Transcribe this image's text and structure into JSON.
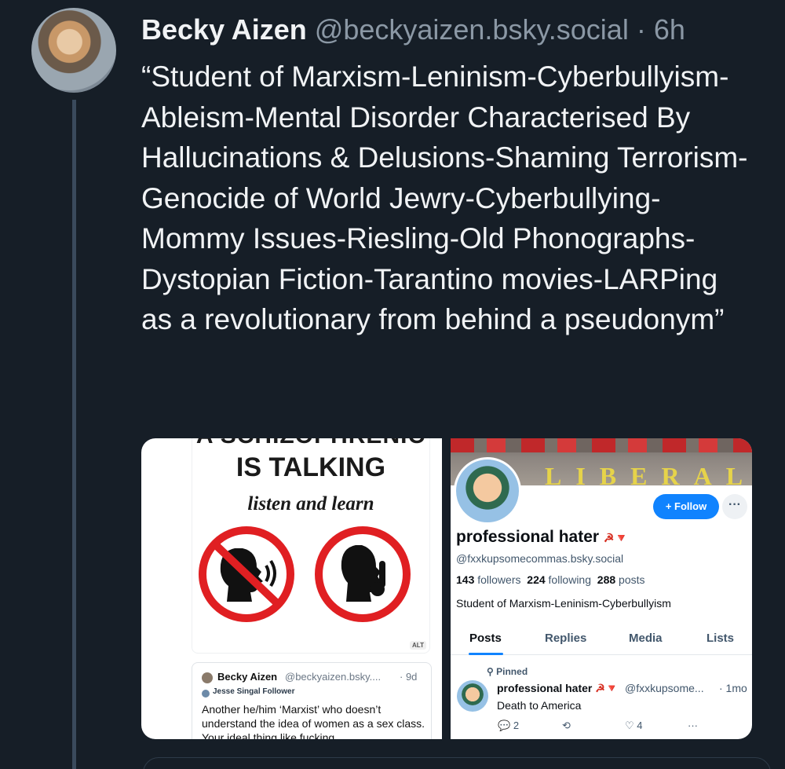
{
  "post": {
    "author_name": "Becky Aizen",
    "author_handle": "@beckyaizen.bsky.social",
    "separator": "·",
    "time": "6h",
    "text": "“Student of Marxism-Leninism-Cyberbullyism-Ableism-Mental Disorder Characterised By Hallucinations & Delusions-Shaming Terrorism-Genocide of World Jewry-Cyberbullying-Mommy Issues-Riesling-Old Phonographs-Dystopian Fiction-Tarantino movies-LARPing as a revolutionary from behind a pseudonym”"
  },
  "left_image": {
    "meme_cut_text": "A SCHIZOPHRENIC",
    "meme_title": "IS TALKING",
    "meme_subtitle": "listen and learn",
    "alt_badge": "ALT",
    "quote": {
      "name": "Becky Aizen",
      "handle": "@beckyaizen.bsky....",
      "time": "· 9d",
      "badge": "Jesse Singal Follower",
      "text": "Another he/him ‘Marxist’ who doesn’t understand the idea of women as a sex class. Your ideal thing like fucking"
    }
  },
  "right_image": {
    "banner_text": "LIBERAL",
    "follow_label": "+ Follow",
    "more_label": "···",
    "name": "professional hater",
    "name_emoji": "☭🔻",
    "handle": "@fxxkupsomecommas.bsky.social",
    "followers_count": "143",
    "followers_label": "followers",
    "following_count": "224",
    "following_label": "following",
    "posts_count": "288",
    "posts_label": "posts",
    "bio": "Student of Marxism-Leninism-Cyberbullyism",
    "tabs": [
      "Posts",
      "Replies",
      "Media",
      "Lists"
    ],
    "pinned_label": "Pinned",
    "pinned_post": {
      "name": "professional hater",
      "emoji": "☭🔻",
      "handle": "@fxxkupsome...",
      "time": "· 1mo",
      "text": "Death to America",
      "replies": "2",
      "likes": "4"
    }
  },
  "colors": {
    "background": "#161e27",
    "text_primary": "#f1f3f5",
    "text_secondary": "#8b98a5",
    "thread_line": "#3a4a5c",
    "follow_blue": "#1083fe"
  }
}
